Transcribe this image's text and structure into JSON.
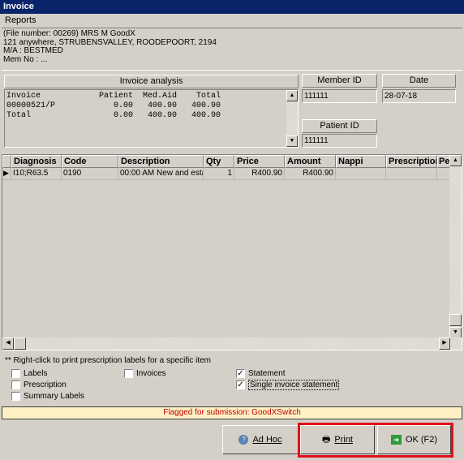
{
  "window": {
    "title": "Invoice"
  },
  "menu": {
    "items": [
      "Reports"
    ]
  },
  "patient": {
    "line1": "(File number: 00269) MRS M GoodX",
    "line2": "121 anywhere, STRUBENSVALLEY, ROODEPOORT, 2194",
    "line3": "M/A : BESTMED",
    "line4": "Mem No : ..."
  },
  "analysis": {
    "header": "Invoice analysis",
    "text": "Invoice            Patient  Med.Aid    Total\n00000521/P            0.00   400.90   400.90\nTotal                 0.00   400.90   400.90"
  },
  "member_id": {
    "label": "Member ID",
    "value": "111111"
  },
  "date": {
    "label": "Date",
    "value": "28-07-18"
  },
  "patient_id": {
    "label": "Patient ID",
    "value": "111111"
  },
  "grid": {
    "columns": [
      "Diagnosis",
      "Code",
      "Description",
      "Qty",
      "Price",
      "Amount",
      "Nappi",
      "Prescription",
      "Pe"
    ],
    "rows": [
      [
        "I10;R63.5",
        "0190",
        "00:00 AM New and esta",
        "1",
        "R400.90",
        "R400.90",
        "",
        "",
        ""
      ]
    ]
  },
  "options": {
    "hint": "** Right-click to print prescription labels for a specific item",
    "labels": {
      "label": "Labels",
      "checked": false
    },
    "prescription": {
      "label": "Prescription",
      "checked": false
    },
    "summary_labels": {
      "label": "Summary Labels",
      "checked": false
    },
    "invoices": {
      "label": "Invoices",
      "checked": false
    },
    "statement": {
      "label": "Statement",
      "checked": true
    },
    "single_statement": {
      "label": "Single invoice statement",
      "checked": true
    }
  },
  "flagged": {
    "text": "Flagged for submission: GoodXSwitch"
  },
  "buttons": {
    "adhoc": "Ad Hoc",
    "print": "Print",
    "ok": "OK (F2)"
  },
  "colors": {
    "title_bar": "#0a246a",
    "flag_bg": "#fff1c4",
    "flag_text": "#c00000",
    "highlight": "#e0101a"
  }
}
